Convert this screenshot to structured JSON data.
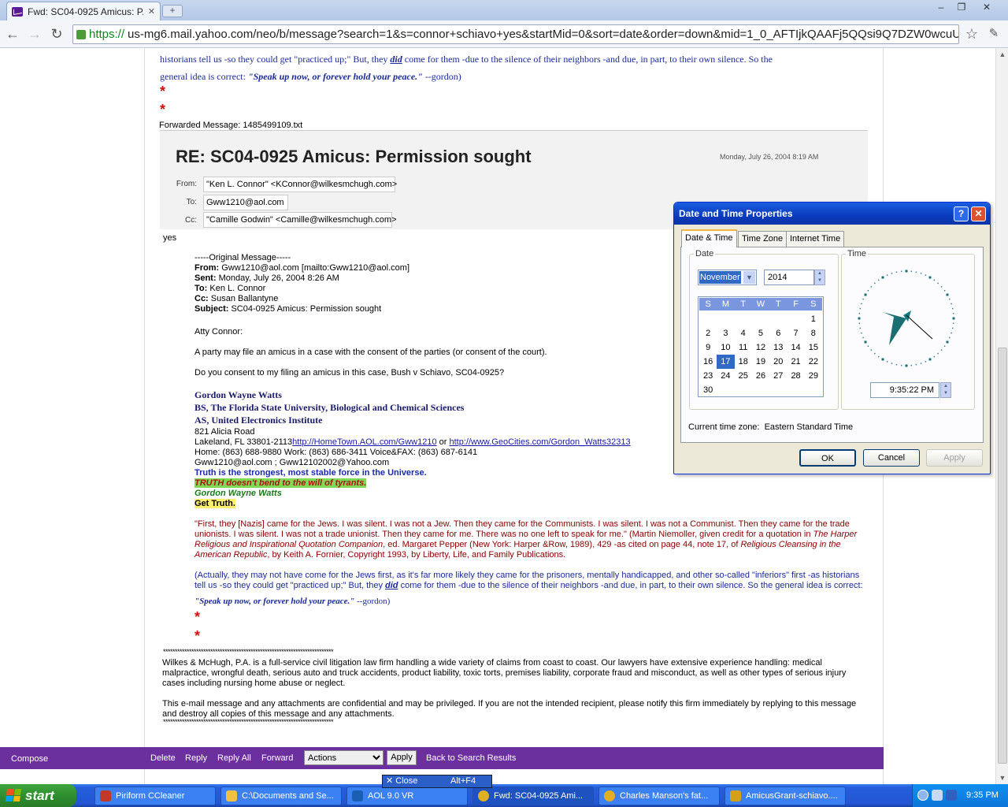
{
  "browser": {
    "tab_title": "Fwd: SC04-0925 Amicus: P...",
    "tab_close": "✕",
    "new_tab": "+",
    "url_scheme": "https://",
    "url_rest": "us-mg6.mail.yahoo.com/neo/b/message?search=1&s=connor+schiavo+yes&startMid=0&sort=date&order=down&mid=1_0_AFTIjkQAAFj5QQsi9Q7DZW0wcuU8&fid=Inbox",
    "bookmark_star": "☆",
    "wrench": "✎"
  },
  "email": {
    "top_paragraph_line1": "historians tell us -so they could get \"practiced up;\" But, they",
    "top_did": "did",
    "top_paragraph_line1b": "come for them -due to the silence of their neighbors -and due, in part, to their own silence. So the",
    "top_paragraph_line2": "general idea is correct:",
    "top_quote": "\"Speak up now, or forever hold your peace.\"",
    "top_sig": "--gordon)",
    "star": "*",
    "forwarded_label": "Forwarded Message: 1485499109.txt",
    "subject": "RE: SC04-0925 Amicus: Permission sought",
    "date": "Monday, July 26, 2004 8:19 AM",
    "from_label": "From:",
    "from_value": "\"Ken L. Connor\" <KConnor@wilkesmchugh.com>",
    "to_label": "To:",
    "to_value": "Gww1210@aol.com",
    "cc_label": "Cc:",
    "cc_value": "\"Camille Godwin\" <Camille@wilkesmchugh.com>",
    "body_yes": "yes",
    "orig_header": "-----Original Message-----",
    "orig_from_label": "From:",
    "orig_from": "Gww1210@aol.com [mailto:Gww1210@aol.com]",
    "orig_sent_label": "Sent:",
    "orig_sent": "Monday, July 26, 2004 8:26 AM",
    "orig_to_label": "To:",
    "orig_to": "Ken L. Connor",
    "orig_cc_label": "Cc:",
    "orig_cc": "Susan Ballantyne",
    "orig_subject_label": "Subject:",
    "orig_subject": "SC04-0925 Amicus: Permission sought",
    "greeting": "Atty Connor:",
    "para1": "A party may file an amicus in a case with the consent of the parties (or consent of the court).",
    "para2": "Do you consent to my filing an amicus in this case, Bush v Schiavo, SC04-0925?",
    "sig_name": "Gordon Wayne Watts",
    "sig_bs": "BS, The Florida State University, Biological and Chemical Sciences",
    "sig_as": "AS, United Electronics Institute",
    "sig_addr1": "821 Alicia Road",
    "sig_addr2": "Lakeland, FL 33801-2113",
    "sig_link1": "http://HomeTown.AOL.com/Gww1210",
    "sig_or": "or",
    "sig_link2": "http://www.GeoCities.com/Gordon_Watts32313",
    "sig_phone": "Home: (863) 688-9880 Work: (863) 686-3411 Voice&FAX: (863) 687-6141",
    "sig_emails": "Gww1210@aol.com ; Gww12102002@Yahoo.com",
    "truth1": "Truth is the strongest, most stable force in the Universe.",
    "truth2": "TRUTH doesn't bend to the will of tyrants.",
    "truth3": "Gordon Wayne Watts",
    "truth4": "Get Truth.",
    "quote_line1": "\"First, they [Nazis] came for the Jews. I was silent. I was not a Jew. Then they came for the Communists. I was silent. I was not a Communist. Then they came for the trade",
    "quote_line2a": "unionists. I was silent. I was not a trade unionist. Then they came for me. There was no one left to speak for me.\" (Martin Niemoller, given credit for a quotation in",
    "quote_line2b": "The Harper",
    "quote_line3a": "Religious and Inspirational Quotation Companion",
    "quote_line3b": ", ed. Margaret Pepper (New York: Harper &Row, 1989), 429 -as cited on page 44, note 17, of",
    "quote_line3c": "Religious Cleansing in the",
    "quote_line4a": "American Republic",
    "quote_line4b": ", by Keith A. Fornier, Copyright 1993, by Liberty, Life, and Family Publications.",
    "actual_line1": "(Actually, they may not have come for the Jews first, as it's far more likely they came for the prisoners, mentally handicapped, and other so-called \"inferiors\" first -as historians",
    "actual_line2a": "tell us -so they could get \"practiced up;\" But, they",
    "actual_did": "did",
    "actual_line2b": "come for them -due to the silence of their neighbors -and due, in part, to their own silence. So the general idea is correct:",
    "speak_up": "\"Speak up now, or forever hold your peace.\"",
    "speak_sig": "--gordon)",
    "stars_line": "************************************************************************",
    "disclaimer1": "Wilkes & McHugh, P.A. is a full-service civil litigation law firm handling a wide variety of claims from coast to coast. Our lawyers have extensive experience handling: medical malpractice, wrongful death, serious auto and truck accidents, product liability, toxic torts, premises liability, corporate fraud and misconduct, as well as other types of serious injury cases including nursing home abuse or neglect.",
    "disclaimer2": "This e-mail message and any attachments are confidential and may be privileged. If you are not the intended recipient, please notify this firm immediately by replying to this message and destroy all copies of this message and any attachments."
  },
  "actions": {
    "compose": "Compose",
    "delete": "Delete",
    "reply": "Reply",
    "reply_all": "Reply All",
    "forward": "Forward",
    "actions_select": "Actions",
    "apply": "Apply",
    "back": "Back to Search Results"
  },
  "dialog": {
    "title": "Date and Time Properties",
    "help": "?",
    "close": "✕",
    "tabs": [
      "Date & Time",
      "Time Zone",
      "Internet Time"
    ],
    "date_group": "Date",
    "time_group": "Time",
    "month": "November",
    "year": "2014",
    "weekdays": [
      "S",
      "M",
      "T",
      "W",
      "T",
      "F",
      "S"
    ],
    "days": [
      "",
      "",
      "",
      "",
      "",
      "",
      "1",
      "2",
      "3",
      "4",
      "5",
      "6",
      "7",
      "8",
      "9",
      "10",
      "11",
      "12",
      "13",
      "14",
      "15",
      "16",
      "17",
      "18",
      "19",
      "20",
      "21",
      "22",
      "23",
      "24",
      "25",
      "26",
      "27",
      "28",
      "29",
      "30"
    ],
    "selected_day": "17",
    "time_value": "9:35:22 PM",
    "tz_label": "Current time zone:  Eastern Standard Time",
    "ok": "OK",
    "cancel": "Cancel",
    "apply": "Apply"
  },
  "tooltip": {
    "close": "Close",
    "shortcut": "Alt+F4"
  },
  "taskbar": {
    "start": "start",
    "items": [
      "Piriform CCleaner",
      "C:\\Documents and Se...",
      "AOL 9.0 VR",
      "Fwd: SC04-0925 Ami...",
      "Charles Manson's fat...",
      "AmicusGrant-schiavo...."
    ],
    "clock": "9:35 PM"
  },
  "colors": {
    "yahoo_purple": "#6b2f9e",
    "xp_blue": "#245edb",
    "start_green": "#3fa53f"
  }
}
